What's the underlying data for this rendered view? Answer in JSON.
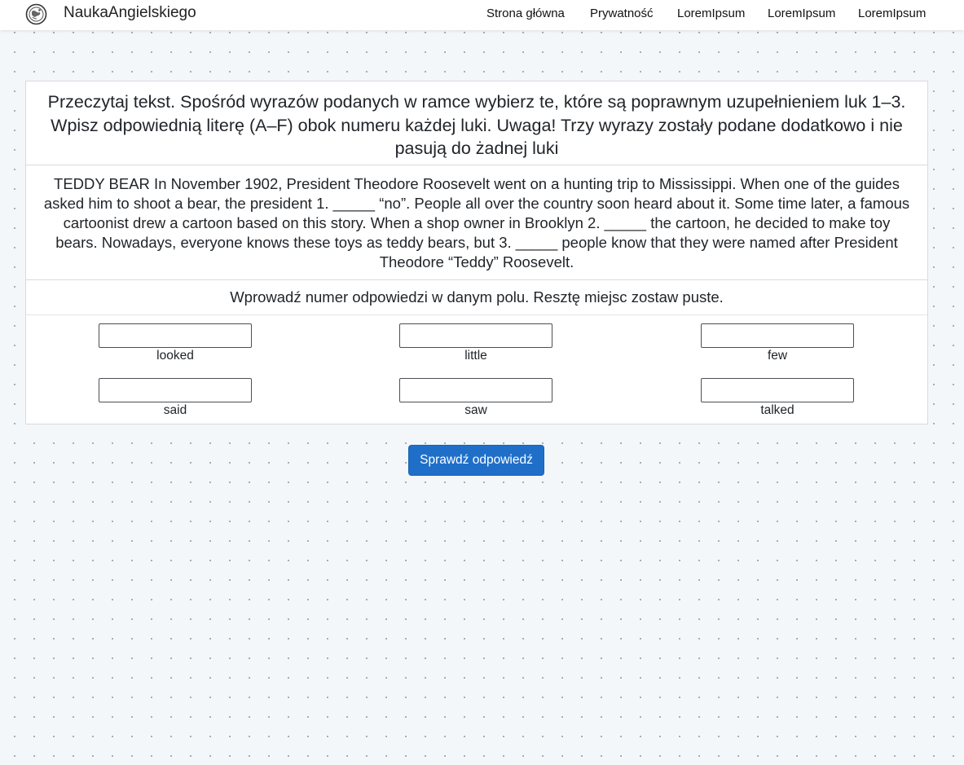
{
  "header": {
    "brand": "NaukaAngielskiego",
    "nav": [
      "Strona główna",
      "Prywatność",
      "LoremIpsum",
      "LoremIpsum",
      "LoremIpsum"
    ]
  },
  "exercise": {
    "instruction": "Przeczytaj tekst. Spośród wyrazów podanych w ramce wybierz te, które są poprawnym uzupełnieniem luk 1–3. Wpisz odpowiednią literę (A–F) obok numeru każdej luki. Uwaga! Trzy wyrazy zostały podane dodatkowo i nie pasują do żadnej luki",
    "passage": "TEDDY BEAR In November 1902, President Theodore Roosevelt went on a hunting trip to Mississippi. When one of the guides asked him to shoot a bear, the president 1. _____ “no”. People all over the country soon heard about it. Some time later, a famous cartoonist drew a cartoon based on this story. When a shop owner in Brooklyn 2. _____ the cartoon, he decided to make toy bears. Nowadays, everyone knows these toys as teddy bears, but 3. _____ people know that they were named after President Theodore “Teddy” Roosevelt.",
    "hint": "Wprowadź numer odpowiedzi w danym polu. Resztę miejsc zostaw puste.",
    "options": [
      {
        "word": "looked",
        "value": ""
      },
      {
        "word": "little",
        "value": ""
      },
      {
        "word": "few",
        "value": ""
      },
      {
        "word": "said",
        "value": ""
      },
      {
        "word": "saw",
        "value": ""
      },
      {
        "word": "talked",
        "value": ""
      }
    ],
    "submit_label": "Sprawdź odpowiedź"
  },
  "colors": {
    "primary_button": "#1f6fc9",
    "background": "#f4f7fa"
  }
}
